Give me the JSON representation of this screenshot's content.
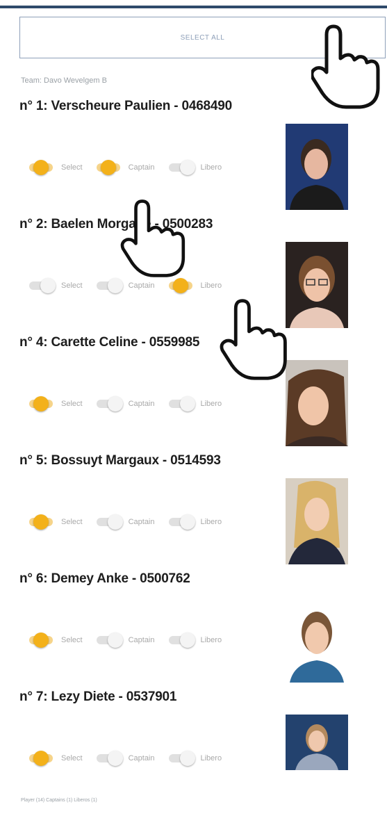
{
  "select_all_label": "SELECT ALL",
  "team_label": "Team: Davo Wevelgem B",
  "toggle_labels": {
    "select": "Select",
    "captain": "Captain",
    "libero": "Libero"
  },
  "colors": {
    "accent": "#f3b11a",
    "header_bar": "#2f4a6b"
  },
  "players": [
    {
      "title": "n° 1: Verscheure Paulien - 0468490",
      "select": true,
      "captain": true,
      "libero": false
    },
    {
      "title": "n° 2: Baelen Morgane - 0500283",
      "select": false,
      "captain": false,
      "libero": true
    },
    {
      "title": "n° 4: Carette Celine - 0559985",
      "select": true,
      "captain": false,
      "libero": false
    },
    {
      "title": "n° 5: Bossuyt Margaux - 0514593",
      "select": true,
      "captain": false,
      "libero": false
    },
    {
      "title": "n° 6: Demey Anke - 0500762",
      "select": true,
      "captain": false,
      "libero": false
    },
    {
      "title": "n° 7: Lezy Diete - 0537901",
      "select": true,
      "captain": false,
      "libero": false
    }
  ],
  "footer_text": "Player (14) Captains (1) Liberos (1)",
  "overlay_icons": [
    "tap-hand-icon",
    "tap-hand-icon",
    "tap-hand-icon"
  ]
}
